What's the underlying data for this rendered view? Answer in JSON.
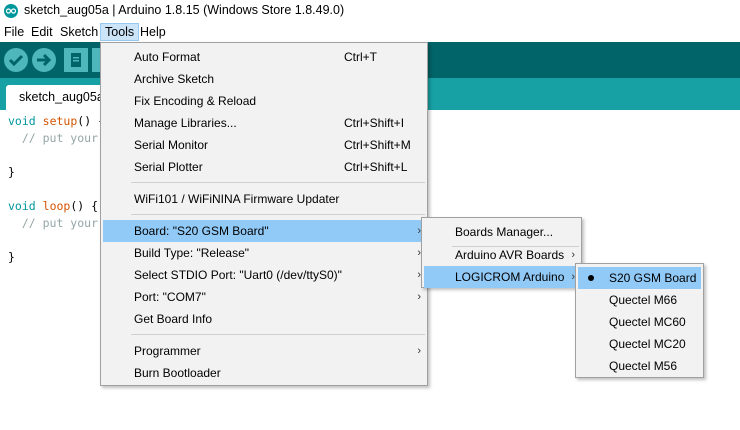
{
  "window": {
    "title": "sketch_aug05a | Arduino 1.8.15 (Windows Store 1.8.49.0)"
  },
  "menubar": {
    "items": [
      "File",
      "Edit",
      "Sketch",
      "Tools",
      "Help"
    ],
    "open": "Tools"
  },
  "toolbar": {
    "buttons": [
      "verify-icon",
      "upload-icon",
      "new-icon",
      "open-icon"
    ]
  },
  "tabs": [
    {
      "label": "sketch_aug05a"
    }
  ],
  "editor": {
    "lines": [
      {
        "kw": "void",
        "fn": "setup",
        "rest": "() {"
      },
      {
        "comment": "  // put your"
      },
      {
        "text": ""
      },
      {
        "text": "}"
      },
      {
        "text": ""
      },
      {
        "kw": "void",
        "fn": "loop",
        "rest": "() {"
      },
      {
        "comment": "  // put your"
      },
      {
        "text": ""
      },
      {
        "text": "}"
      }
    ]
  },
  "tools_menu": {
    "items": [
      {
        "label": "Auto Format",
        "shortcut": "Ctrl+T"
      },
      {
        "label": "Archive Sketch"
      },
      {
        "label": "Fix Encoding & Reload"
      },
      {
        "label": "Manage Libraries...",
        "shortcut": "Ctrl+Shift+I"
      },
      {
        "label": "Serial Monitor",
        "shortcut": "Ctrl+Shift+M"
      },
      {
        "label": "Serial Plotter",
        "shortcut": "Ctrl+Shift+L"
      },
      {
        "label": "WiFi101 / WiFiNINA Firmware Updater"
      },
      {
        "label": "Board: \"S20 GSM Board\"",
        "submenu": true,
        "highlighted": true
      },
      {
        "label": "Build Type: \"Release\"",
        "submenu": true
      },
      {
        "label": "Select STDIO Port: \"Uart0 (/dev/ttyS0)\"",
        "submenu": true
      },
      {
        "label": "Port: \"COM7\"",
        "submenu": true
      },
      {
        "label": "Get Board Info"
      },
      {
        "label": "Programmer",
        "submenu": true
      },
      {
        "label": "Burn Bootloader"
      }
    ]
  },
  "board_menu": {
    "items": [
      {
        "label": "Boards Manager..."
      },
      {
        "label": "Arduino AVR Boards",
        "submenu": true
      },
      {
        "label": "LOGICROM Arduino",
        "submenu": true,
        "highlighted": true
      }
    ]
  },
  "logicrom_menu": {
    "items": [
      {
        "label": "S20 GSM Board",
        "selected": true,
        "highlighted": true
      },
      {
        "label": "Quectel M66"
      },
      {
        "label": "Quectel MC60"
      },
      {
        "label": "Quectel MC20"
      },
      {
        "label": "Quectel M56"
      }
    ]
  },
  "glyphs": {
    "submenu_arrow": "›"
  },
  "colors": {
    "toolbar": "#006468",
    "tabbar": "#17a1a5",
    "highlight": "#91c9f7"
  }
}
